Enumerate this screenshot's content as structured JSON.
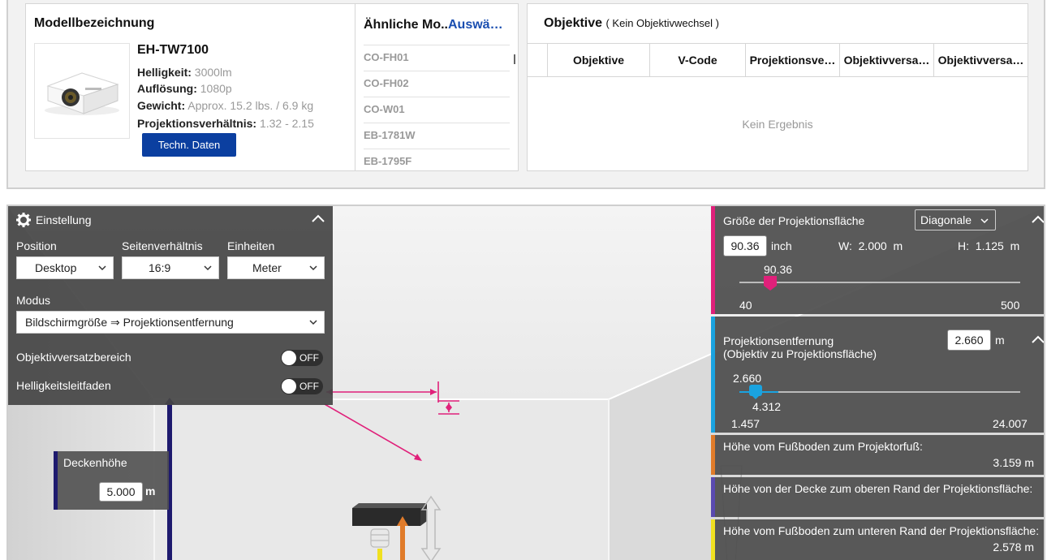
{
  "model_card": {
    "header": "Modellbezeichnung",
    "name": "EH-TW7100",
    "specs": [
      {
        "label": "Helligkeit:",
        "value": "3000lm"
      },
      {
        "label": "Auflösung:",
        "value": "1080p"
      },
      {
        "label": "Gewicht:",
        "value": "Approx. 15.2 lbs. / 6.9 kg"
      },
      {
        "label": "Projektionsverhältnis:",
        "value": "1.32 - 2.15"
      }
    ],
    "spec_button": "Techn. Daten",
    "similar_header": "Ähnliche Mo..",
    "similar_link": "Auswä…",
    "similar_models": [
      "CO-FH01",
      "CO-FH02",
      "CO-W01",
      "EB-1781W",
      "EB-1795F"
    ]
  },
  "lens_card": {
    "header": "Objektive",
    "subheader": "( Kein Objektivwechsel )",
    "columns": [
      "Objektive",
      "V-Code",
      "Projektionsve…",
      "Objektivversa…",
      "Objektivversa…"
    ],
    "empty_text": "Kein Ergebnis"
  },
  "settings": {
    "title": "Einstellung",
    "position_label": "Position",
    "position_value": "Desktop",
    "aspect_label": "Seitenverhältnis",
    "aspect_value": "16:9",
    "units_label": "Einheiten",
    "units_value": "Meter",
    "mode_label": "Modus",
    "mode_value": "Bildschirmgröße ⇒ Projektionsentfernung",
    "lens_shift_label": "Objektivversatzbereich",
    "lens_shift_state": "OFF",
    "brightness_label": "Helligkeitsleitfaden",
    "brightness_state": "OFF"
  },
  "ceiling": {
    "label": "Deckenhöhe",
    "value": "5.000",
    "unit": "m"
  },
  "screen_size": {
    "label": "Größe der Projektionsfläche",
    "dropdown": "Diagonale",
    "value": "90.36",
    "unit": "inch",
    "width_label": "W:",
    "width_value": "2.000",
    "width_unit": "m",
    "height_label": "H:",
    "height_value": "1.125",
    "height_unit": "m",
    "slider_value": "90.36",
    "slider_min": "40",
    "slider_max": "500",
    "accent": "#e0207a"
  },
  "throw_distance": {
    "label_line1": "Projektionsentfernung",
    "label_line2": "(Objektiv zu Projektionsfläche)",
    "value": "2.660",
    "unit": "m",
    "slider_value_top": "2.660",
    "slider_value_bottom": "4.312",
    "slider_min": "1.457",
    "slider_max": "24.007",
    "accent": "#1aa3e0"
  },
  "floor_to_projector": {
    "label": "Höhe vom Fußboden zum Projektorfuß:",
    "value": "3.159 m",
    "accent": "#e07b2a"
  },
  "ceiling_to_screen": {
    "label": "Höhe von der Decke zum oberen Rand der Projektionsfläche:",
    "accent": "#5a4ab0"
  },
  "floor_to_screen_bottom": {
    "label": "Höhe vom Fußboden zum unteren Rand der Projektionsfläche:",
    "value": "2.578 m",
    "accent": "#f0e020"
  }
}
